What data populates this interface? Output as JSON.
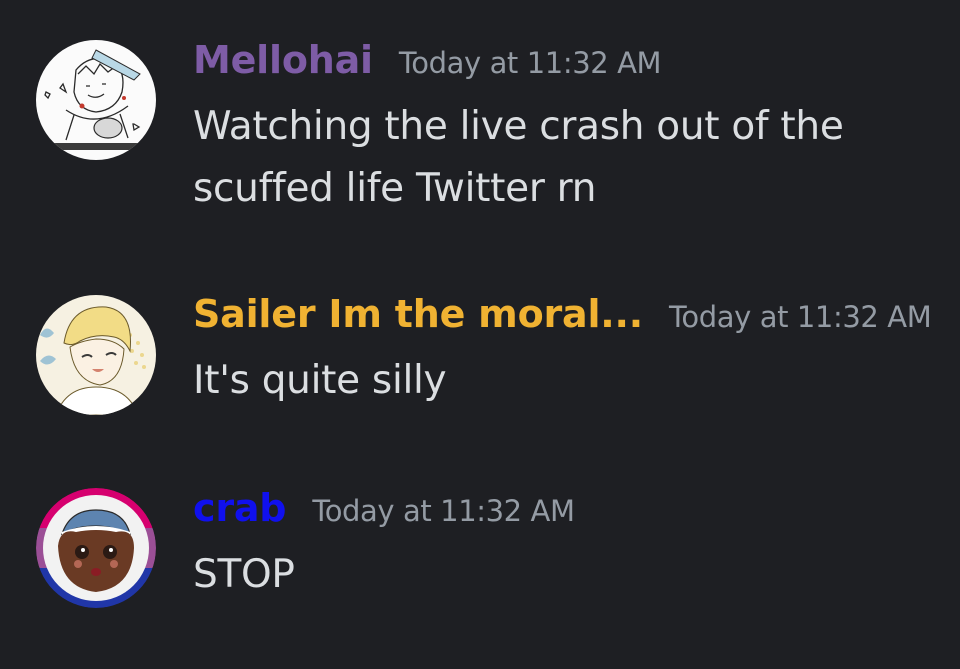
{
  "messages": [
    {
      "username": "Mellohai",
      "username_color": "#7e5ca6",
      "timestamp": "Today at 11:32 AM",
      "text": "Watching the live crash out of the scuffed life Twitter rn",
      "avatar": "sketch-character-avatar"
    },
    {
      "username": "Sailer Im the moral...",
      "username_color": "#f0b232",
      "timestamp": "Today at 11:32 AM",
      "text": "It's quite silly",
      "avatar": "blonde-character-avatar"
    },
    {
      "username": "crab",
      "username_color": "#1010ee",
      "timestamp": "Today at 11:32 AM",
      "text": "STOP",
      "avatar": "beanie-character-avatar"
    }
  ],
  "colors": {
    "background": "#1e1f23",
    "text": "#dbdee1",
    "timestamp": "#949ba4"
  }
}
